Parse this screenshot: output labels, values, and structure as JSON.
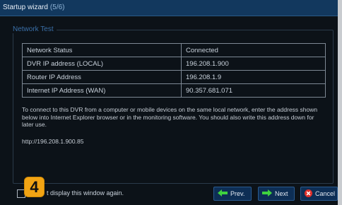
{
  "window": {
    "title": "Startup wizard",
    "step": "(5/6)"
  },
  "group": {
    "legend": "Network Test"
  },
  "table": {
    "rows": [
      {
        "label": "Network Status",
        "value": "Connected"
      },
      {
        "label": "DVR IP address (LOCAL)",
        "value": "196.208.1.900"
      },
      {
        "label": "Router IP Address",
        "value": "196.208.1.9"
      },
      {
        "label": "Internet IP Address (WAN)",
        "value": "90.357.681.071"
      }
    ]
  },
  "description": "To connect to this DVR from a computer or mobile devices on the same local network, enter the address shown below into Internet Explorer browser or in the monitoring software. You should also write this address down for later use.",
  "url": "http://196.208.1.900.85",
  "badge": "4",
  "footer": {
    "checkbox_label": "t display this window again."
  },
  "buttons": {
    "prev": "Prev.",
    "next": "Next",
    "cancel": "Cancel"
  },
  "colors": {
    "title_bar": "#12385e",
    "arrow_green": "#3fd23f",
    "cancel_red": "#e0302a",
    "badge": "#f2a414"
  },
  "icons": {
    "prev": "arrow-left-icon",
    "next": "arrow-right-icon",
    "cancel": "close-icon"
  }
}
